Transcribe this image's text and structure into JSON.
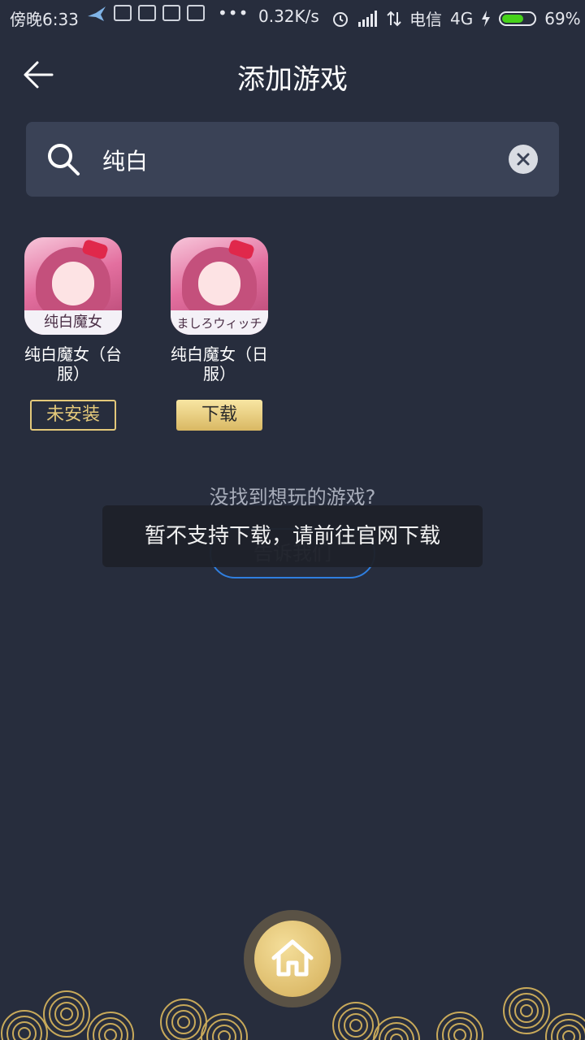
{
  "status_bar": {
    "time": "傍晚6:33",
    "more": "•••",
    "speed": "0.32K/s",
    "carrier": "电信",
    "network": "4G",
    "battery_level": 0.69,
    "battery": "69%"
  },
  "header": {
    "title": "添加游戏"
  },
  "search": {
    "value": "纯白"
  },
  "games": [
    {
      "name": "纯白魔女（台服）",
      "icon_text": "纯白魔女",
      "button": "未安装"
    },
    {
      "name": "纯白魔女（日服）",
      "icon_text": "ましろウィッチ",
      "button": "下载"
    }
  ],
  "not_found": {
    "text": "没找到想玩的游戏?",
    "button": "告诉我们"
  },
  "toast": {
    "text": "暂不支持下载，请前往官网下载"
  },
  "colors": {
    "background": "#272d3d",
    "gold": "#e3c87a",
    "accent_blue": "#2f7fe0"
  }
}
